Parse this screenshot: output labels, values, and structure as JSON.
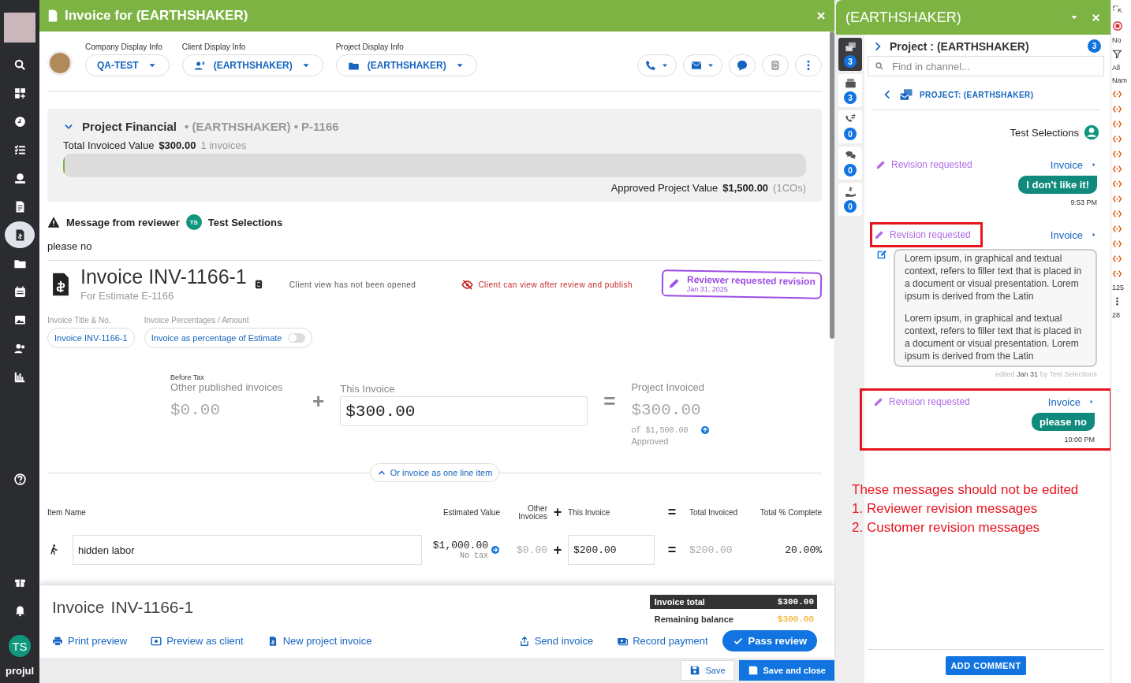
{
  "sidebar": {
    "items": [
      {
        "selected": false
      },
      {
        "selected": false
      },
      {
        "selected": false
      },
      {
        "selected": false
      },
      {
        "selected": false
      },
      {
        "selected": false
      },
      {
        "selected": true
      },
      {
        "selected": false
      },
      {
        "selected": false
      },
      {
        "selected": false
      },
      {
        "selected": false
      },
      {
        "selected": false
      }
    ],
    "user_initials": "TS",
    "logo": "projul"
  },
  "invoice_window": {
    "title": "Invoice for (EARTHSHAKER)",
    "display_info": [
      {
        "label": "Company Display Info",
        "value": "QA-TEST",
        "kind": "company"
      },
      {
        "label": "Client Display Info",
        "value": "(EARTHSHAKER)",
        "kind": "client"
      },
      {
        "label": "Project Display Info",
        "value": "(EARTHSHAKER)",
        "kind": "project"
      }
    ],
    "financial": {
      "title": "Project Financial",
      "subtitle": "• (EARTHSHAKER) • P-1166",
      "invoiced_label": "Total Invoiced Value",
      "invoiced_value": "$300.00",
      "invoice_count": "1 invoices",
      "level": 0,
      "approved_label": "Approved Project Value",
      "approved_value": "$1,500.00",
      "approved_note": "(1COs)"
    },
    "reviewer_message": {
      "label": "Message from reviewer",
      "initials": "TS",
      "name": "Test Selections",
      "text": "please no"
    },
    "invoice": {
      "title": "Invoice INV-1166-1",
      "subtitle": "For Estimate E-1166",
      "view_status": "Client view has not been opened",
      "visibility": "Client can view after review and publish",
      "stamp": {
        "title": "Reviewer requested revision",
        "date": "Jan 31, 2025"
      },
      "title_field": {
        "label": "Invoice Title & No.",
        "value": "Invoice INV-1166-1"
      },
      "percent_field": {
        "label": "Invoice Percentages / Amount",
        "value": "Invoice as percentage of Estimate",
        "on": false
      }
    },
    "calc": {
      "note": "Before Tax",
      "other_label": "Other published invoices",
      "other_value": "$0.00",
      "plus": "+",
      "this_label": "This Invoice",
      "this_value": "$300.00",
      "equals": "=",
      "total_label": "Project Invoiced",
      "total_value": "$300.00",
      "of_value": "of $1,500.00",
      "approved": "Approved"
    },
    "line_item_toggle": "Or invoice as one line item",
    "table": {
      "columns": [
        "Item Name",
        "Estimated Value",
        "Other Invoices",
        "+",
        "This Invoice",
        "=",
        "Total Invoiced",
        "Total % Complete"
      ],
      "rows": [
        {
          "name": "hidden labor",
          "estimated": "$1,000.00",
          "tax": "No tax",
          "other": "$0.00",
          "plus": "+",
          "this": "$200.00",
          "equals": "=",
          "total": "$200.00",
          "percent": "20.00%"
        }
      ]
    },
    "footer": {
      "word": "Invoice",
      "number": "INV-1166-1",
      "total_label": "Invoice total",
      "total_value": "$300.00",
      "balance_label": "Remaining balance",
      "balance_value": "$300.00",
      "actions": [
        {
          "label": "Print preview",
          "kind": "print"
        },
        {
          "label": "Preview as client",
          "kind": "preview"
        },
        {
          "label": "New project invoice",
          "kind": "new"
        },
        {
          "label": "Send invoice",
          "kind": "send"
        },
        {
          "label": "Record payment",
          "kind": "payment"
        }
      ],
      "primary": "Pass review"
    },
    "save_bar": {
      "save": "Save",
      "save_close": "Save and close"
    }
  },
  "chat": {
    "title": "(EARTHSHAKER)",
    "rail": [
      {
        "count": "3",
        "selected": true
      },
      {
        "count": "3",
        "selected": false
      },
      {
        "count": "0",
        "selected": false
      },
      {
        "count": "0",
        "selected": false
      },
      {
        "count": "0",
        "selected": false
      }
    ],
    "channel": "Project : (EARTHSHAKER)",
    "channel_count": "3",
    "search_placeholder": "Find in channel...",
    "breadcrumb": "PROJECT: (EARTHSHAKER)",
    "author": "Test Selections",
    "messages": [
      {
        "label": "Revision requested",
        "link": "Invoice",
        "kind": "bubble",
        "text": "I don't like it!",
        "time": "9:53 PM",
        "label_highlighted": false,
        "message_highlighted": false
      },
      {
        "label": "Revision requested",
        "link": "Invoice",
        "kind": "card",
        "paragraphs": [
          "Lorem ipsum, in graphical and textual context, refers to filler text that is placed in a document or visual presentation. Lorem ipsum is derived from the Latin",
          "Lorem ipsum, in graphical and textual context, refers to filler text that is placed in a document or visual presentation. Lorem ipsum is derived from the Latin"
        ],
        "edited": "edited",
        "edited_date": "Jan 31",
        "edited_by": "by Test Selections",
        "label_highlighted": true,
        "message_highlighted": false
      },
      {
        "label": "Revision requested",
        "link": "Invoice",
        "kind": "bubble",
        "text": "please no",
        "time": "10:00 PM",
        "label_highlighted": false,
        "message_highlighted": true
      }
    ],
    "annotation": [
      "These messages should not be edited",
      "1. Reviewer revision messages",
      "2. Customer revision messages"
    ],
    "add_comment": "ADD COMMENT"
  },
  "right_strip": {
    "texts": [
      "No",
      "All",
      "Nam",
      "125",
      "28"
    ]
  }
}
